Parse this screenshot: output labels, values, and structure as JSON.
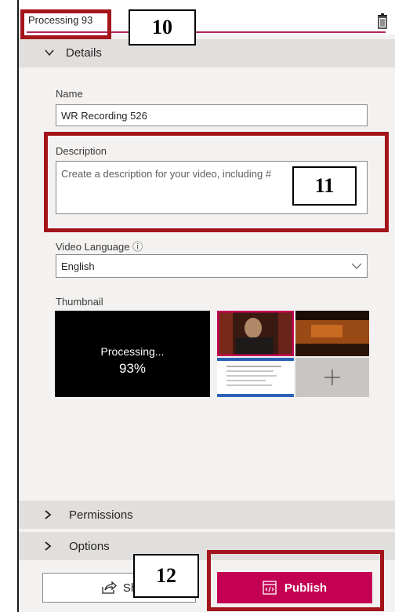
{
  "header": {
    "processing_tab": "Processing 93",
    "delete_icon": "trash-icon"
  },
  "details": {
    "label": "Details",
    "name_label": "Name",
    "name_value": "WR Recording 526",
    "description_label": "Description",
    "description_placeholder": "Create a description for your video, including #",
    "language_label": "Video Language ⓘ",
    "language_value": "English",
    "thumbnail_label": "Thumbnail",
    "processing_text": "Processing...",
    "processing_percent": "93%"
  },
  "sections": {
    "permissions": "Permissions",
    "options": "Options"
  },
  "actions": {
    "share_label": "Sh",
    "publish_label": "Publish"
  },
  "annotations": {
    "label_10": "10",
    "label_11": "11",
    "label_12": "12"
  },
  "colors": {
    "accent": "#c30052",
    "annotation_red": "#a4141b"
  }
}
